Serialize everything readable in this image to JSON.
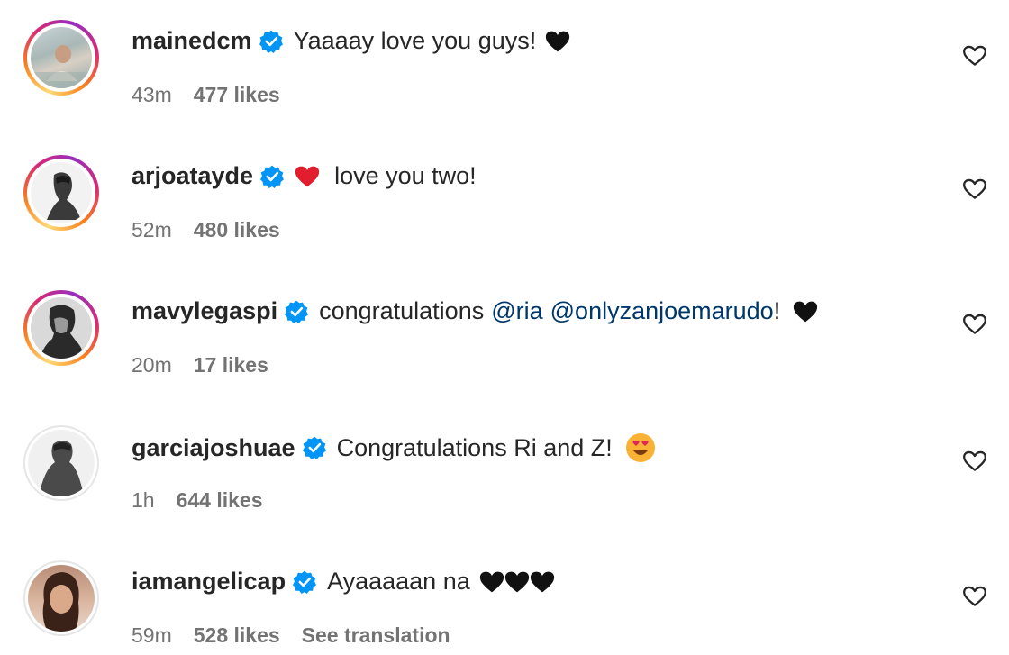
{
  "comments": [
    {
      "username": "mainedcm",
      "verified": true,
      "text_before": "Yaaaay love you guys!",
      "emoji": "black-heart",
      "time": "43m",
      "likes": "477 likes",
      "ring": "gradient"
    },
    {
      "username": "arjoatayde",
      "verified": true,
      "emoji_before": "red-heart",
      "text_before": "love you two!",
      "time": "52m",
      "likes": "480 likes",
      "ring": "gradient"
    },
    {
      "username": "mavylegaspi",
      "verified": true,
      "text_before": "congratulations",
      "mention1": "@ria",
      "mention2": "@onlyzanjoemarudo",
      "text_after": "!",
      "emoji": "black-heart",
      "time": "20m",
      "likes": "17 likes",
      "ring": "gradient"
    },
    {
      "username": "garciajoshuae",
      "verified": true,
      "text_before": "Congratulations Ri and Z!",
      "emoji": "heart-eyes",
      "time": "1h",
      "likes": "644 likes",
      "ring": "plain"
    },
    {
      "username": "iamangelicap",
      "verified": true,
      "text_before": "Ayaaaaan na",
      "emoji": "black-heart x3",
      "time": "59m",
      "likes": "528 likes",
      "see_translation": "See translation",
      "ring": "plain"
    }
  ],
  "colors": {
    "verified_blue": "#0095f6",
    "mention": "#00376b",
    "meta": "#737373",
    "text": "#262626",
    "red_heart": "#e11d2e"
  }
}
